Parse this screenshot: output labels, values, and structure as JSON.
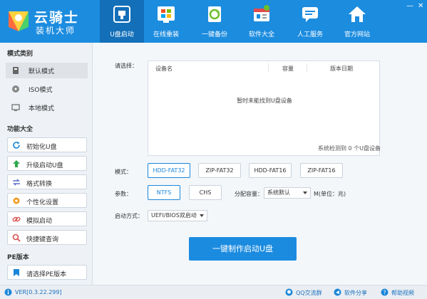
{
  "app": {
    "title": "云骑士",
    "subtitle": "装机大师",
    "window_controls": {
      "minimize": "—",
      "close": "✕"
    }
  },
  "nav": {
    "tabs": [
      {
        "label": "U盘启动",
        "icon": "usb-icon",
        "active": true
      },
      {
        "label": "在线重装",
        "icon": "windows-icon",
        "active": false
      },
      {
        "label": "一键备份",
        "icon": "backup-icon",
        "active": false
      },
      {
        "label": "软件大全",
        "icon": "software-icon",
        "active": false
      },
      {
        "label": "人工服务",
        "icon": "chat-icon",
        "active": false
      },
      {
        "label": "官方网站",
        "icon": "home-icon",
        "active": false
      }
    ]
  },
  "sidebar": {
    "mode_heading": "模式类别",
    "modes": [
      {
        "label": "默认模式",
        "icon": "usb-drive-icon",
        "active": true
      },
      {
        "label": "ISO模式",
        "icon": "disc-icon",
        "active": false
      },
      {
        "label": "本地模式",
        "icon": "monitor-icon",
        "active": false
      }
    ],
    "func_heading": "功能大全",
    "functions": [
      {
        "label": "初始化U盘",
        "icon": "refresh-icon"
      },
      {
        "label": "升级启动U盘",
        "icon": "upgrade-arrow-icon"
      },
      {
        "label": "格式转换",
        "icon": "convert-icon"
      },
      {
        "label": "个性化设置",
        "icon": "settings-icon"
      },
      {
        "label": "模拟启动",
        "icon": "link-icon"
      },
      {
        "label": "快捷键查询",
        "icon": "search-icon"
      }
    ],
    "pe_heading": "PE版本",
    "pe_button": {
      "label": "请选择PE版本",
      "icon": "bookmark-icon"
    }
  },
  "main": {
    "select_label": "请选择：",
    "table": {
      "columns": [
        "设备名",
        "容量",
        "版本日期"
      ],
      "empty_message": "暂时未能找到U盘设备"
    },
    "device_count": "系统检测到 0 个U盘设备",
    "mode_label": "模式：",
    "mode_options": [
      {
        "label": "HDD-FAT32",
        "selected": true
      },
      {
        "label": "ZIP-FAT32",
        "selected": false
      },
      {
        "label": "HDD-FAT16",
        "selected": false
      },
      {
        "label": "ZIP-FAT16",
        "selected": false
      }
    ],
    "param_label": "参数：",
    "fs_options": [
      {
        "label": "NTFS",
        "selected": true
      },
      {
        "label": "CHS",
        "selected": false
      }
    ],
    "partition_label": "分配容量：",
    "partition_value": "系统默认",
    "unit_label": "M(单位：兆)",
    "boot_label": "启动方式：",
    "boot_value": "UEFI/BIOS双启动",
    "make_button": "一键制作启动U盘"
  },
  "footer": {
    "version": "VER[0.3.22.299]",
    "qq_group": "QQ交流群",
    "share": "软件分享",
    "help": "帮助视频"
  },
  "colors": {
    "header": "#1c8cdf",
    "active_tab": "#136fb8",
    "accent": "#1a86d9",
    "sidebar_bg": "#eef2f6",
    "main_bg": "#f4f7fa"
  }
}
